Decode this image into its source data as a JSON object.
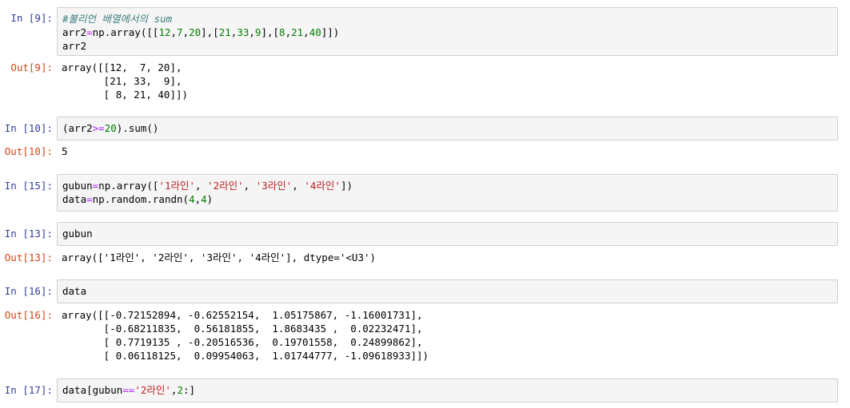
{
  "cells": [
    {
      "in_prompt": "In [9]:",
      "code_lines": [
        "#불리언 배열에서의 sum",
        "arr2=np.array([[12,7,20],[21,33,9],[8,21,40]])",
        "arr2"
      ],
      "out_prompt": "Out[9]:",
      "output_lines": [
        "array([[12,  7, 20],",
        "       [21, 33,  9],",
        "       [ 8, 21, 40]])"
      ]
    },
    {
      "in_prompt": "In [10]:",
      "code_lines": [
        "(arr2>=20).sum()"
      ],
      "out_prompt": "Out[10]:",
      "output_lines": [
        "5"
      ]
    },
    {
      "in_prompt": "In [15]:",
      "code_lines": [
        "gubun=np.array(['1라인', '2라인', '3라인', '4라인'])",
        "data=np.random.randn(4,4)"
      ]
    },
    {
      "in_prompt": "In [13]:",
      "code_lines": [
        "gubun"
      ],
      "out_prompt": "Out[13]:",
      "output_lines": [
        "array(['1라인', '2라인', '3라인', '4라인'], dtype='<U3')"
      ]
    },
    {
      "in_prompt": "In [16]:",
      "code_lines": [
        "data"
      ],
      "out_prompt": "Out[16]:",
      "output_lines": [
        "array([[-0.72152894, -0.62552154,  1.05175867, -1.16001731],",
        "       [-0.68211835,  0.56181855,  1.8683435 ,  0.02232471],",
        "       [ 0.7719135 , -0.20516536,  0.19701558,  0.24899862],",
        "       [ 0.06118125,  0.09954063,  1.01744777, -1.09618933]])"
      ]
    },
    {
      "in_prompt": "In [17]:",
      "code_lines": [
        "data[gubun=='2라인',2:]"
      ]
    }
  ]
}
